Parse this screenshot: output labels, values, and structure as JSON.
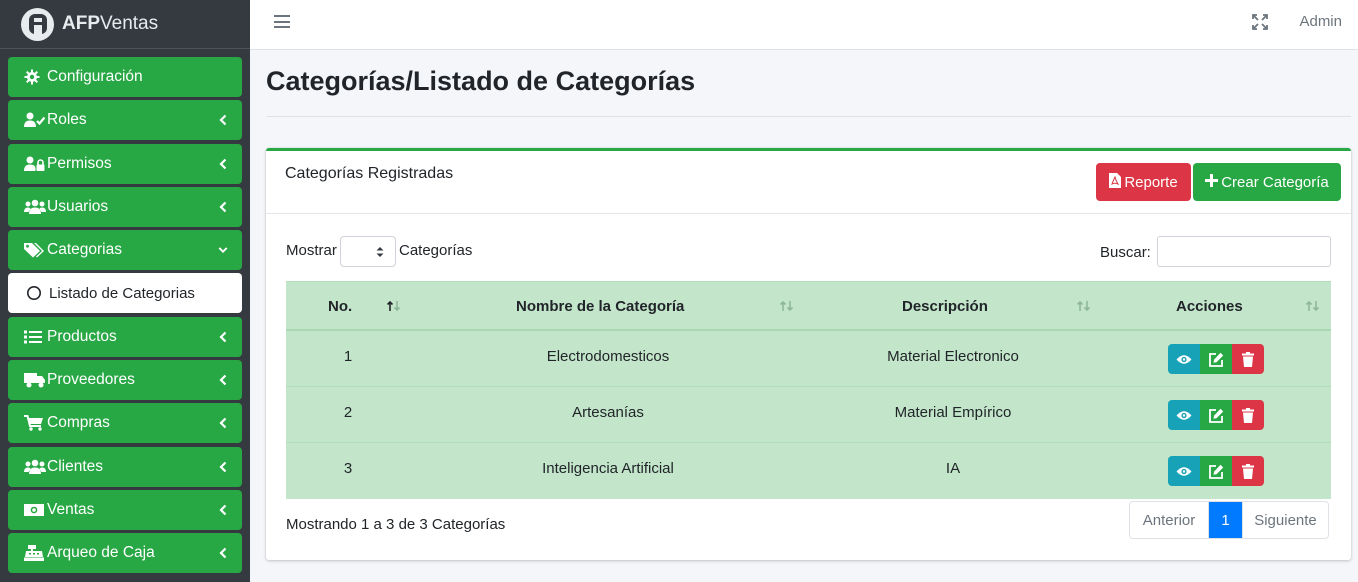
{
  "brand": {
    "bold": "AFP",
    "rest": "Ventas"
  },
  "sidebar": {
    "items": [
      {
        "label": "Configuración",
        "icon": "gear-icon",
        "chevron": ""
      },
      {
        "label": "Roles",
        "icon": "user-check-icon",
        "chevron": "left"
      },
      {
        "label": "Permisos",
        "icon": "user-lock-icon",
        "chevron": "left"
      },
      {
        "label": "Usuarios",
        "icon": "users-icon",
        "chevron": "left"
      },
      {
        "label": "Categorias",
        "icon": "tags-icon",
        "chevron": "down"
      },
      {
        "label": "Listado de Categorias",
        "icon": "circle-icon",
        "chevron": ""
      },
      {
        "label": "Productos",
        "icon": "list-icon",
        "chevron": "left"
      },
      {
        "label": "Proveedores",
        "icon": "truck-icon",
        "chevron": "left"
      },
      {
        "label": "Compras",
        "icon": "cart-icon",
        "chevron": "left"
      },
      {
        "label": "Clientes",
        "icon": "users-icon",
        "chevron": "left"
      },
      {
        "label": "Ventas",
        "icon": "money-icon",
        "chevron": "left"
      },
      {
        "label": "Arqueo de Caja",
        "icon": "cash-register-icon",
        "chevron": "left"
      }
    ]
  },
  "topbar": {
    "user": "Admin"
  },
  "page": {
    "title": "Categorías/Listado de Categorías"
  },
  "card": {
    "title": "Categorías Registradas",
    "report_label": "Reporte",
    "create_label": "Crear Categoría"
  },
  "controls": {
    "show_label": "Mostrar",
    "show_suffix": "Categorías",
    "search_label": "Buscar:",
    "search_value": ""
  },
  "table": {
    "headers": [
      "No.",
      "Nombre de la Categoría",
      "Descripción",
      "Acciones"
    ],
    "rows": [
      {
        "no": "1",
        "name": "Electrodomesticos",
        "desc": "Material Electronico"
      },
      {
        "no": "2",
        "name": "Artesanías",
        "desc": "Material Empírico"
      },
      {
        "no": "3",
        "name": "Inteligencia Artificial",
        "desc": "IA"
      }
    ]
  },
  "footer": {
    "info": "Mostrando 1 a 3 de 3 Categorías",
    "prev": "Anterior",
    "current": "1",
    "next": "Siguiente"
  },
  "colors": {
    "sidebar_bg": "#343a40",
    "nav_green": "#28a745",
    "row_green": "#c3e6cb",
    "danger": "#dc3545",
    "info": "#17a2b8",
    "primary": "#007bff"
  }
}
